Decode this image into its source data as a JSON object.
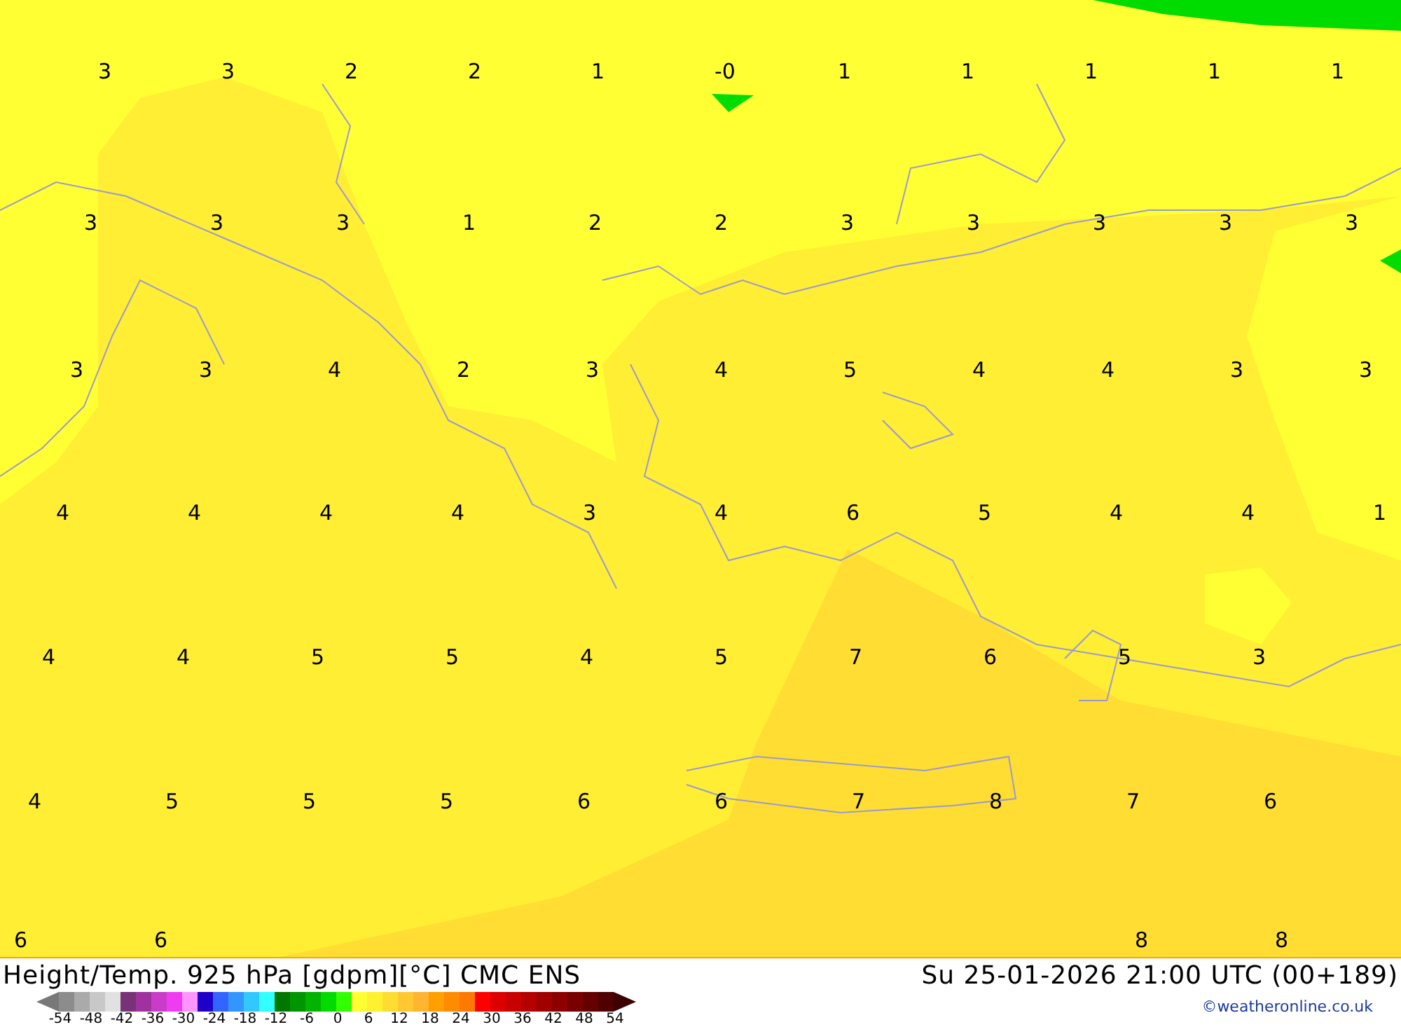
{
  "map": {
    "label_rows": [
      [
        "3",
        "3",
        "2",
        "2",
        "1",
        "-0",
        "1",
        "1",
        "1",
        "1",
        "1"
      ],
      [
        "3",
        "3",
        "3",
        "1",
        "2",
        "2",
        "3",
        "3",
        "3",
        "3",
        "3"
      ],
      [
        "3",
        "3",
        "4",
        "2",
        "3",
        "4",
        "5",
        "4",
        "4",
        "3",
        "3"
      ],
      [
        "4",
        "4",
        "4",
        "4",
        "3",
        "4",
        "6",
        "5",
        "4",
        "4",
        "1"
      ],
      [
        "4",
        "4",
        "5",
        "5",
        "4",
        "5",
        "7",
        "6",
        "5",
        "3",
        null
      ],
      [
        "4",
        "5",
        "5",
        "5",
        "6",
        "6",
        "7",
        "8",
        "7",
        "6",
        null
      ],
      [
        "6",
        "6",
        null,
        null,
        null,
        null,
        null,
        null,
        "8",
        "8",
        null
      ]
    ]
  },
  "footer": {
    "title": "Height/Temp. 925 hPa [gdpm][°C] CMC ENS",
    "time": "Su 25-01-2026 21:00 UTC (00+189)",
    "credit": "©weatheronline.co.uk"
  },
  "legend": {
    "swatches": [
      {
        "kind": "arrow-left",
        "color": "#787878"
      },
      {
        "kind": "box",
        "color": "#8c8c8c"
      },
      {
        "kind": "box",
        "color": "#aaaaaa"
      },
      {
        "kind": "box",
        "color": "#c8c8c8"
      },
      {
        "kind": "box",
        "color": "#e1e1e1"
      },
      {
        "kind": "box",
        "color": "#783278"
      },
      {
        "kind": "box",
        "color": "#a032a0"
      },
      {
        "kind": "box",
        "color": "#c83cc8"
      },
      {
        "kind": "box",
        "color": "#f03cf0"
      },
      {
        "kind": "box",
        "color": "#ff96ff"
      },
      {
        "kind": "box",
        "color": "#1e00c8"
      },
      {
        "kind": "box",
        "color": "#3264ff"
      },
      {
        "kind": "box",
        "color": "#3296ff"
      },
      {
        "kind": "box",
        "color": "#32c8ff"
      },
      {
        "kind": "box",
        "color": "#32ffff"
      },
      {
        "kind": "box",
        "color": "#007800"
      },
      {
        "kind": "box",
        "color": "#009600"
      },
      {
        "kind": "box",
        "color": "#00b400"
      },
      {
        "kind": "box",
        "color": "#00dc00"
      },
      {
        "kind": "box",
        "color": "#32ff00"
      },
      {
        "kind": "box",
        "color": "#ffff32"
      },
      {
        "kind": "box",
        "color": "#fff032"
      },
      {
        "kind": "box",
        "color": "#ffdc32"
      },
      {
        "kind": "box",
        "color": "#ffc832"
      },
      {
        "kind": "box",
        "color": "#ffb432"
      },
      {
        "kind": "box",
        "color": "#ffa000"
      },
      {
        "kind": "box",
        "color": "#ff8c00"
      },
      {
        "kind": "box",
        "color": "#ff7800"
      },
      {
        "kind": "box",
        "color": "#ff0000"
      },
      {
        "kind": "box",
        "color": "#dc0000"
      },
      {
        "kind": "box",
        "color": "#c80000"
      },
      {
        "kind": "box",
        "color": "#b40000"
      },
      {
        "kind": "box",
        "color": "#a00000"
      },
      {
        "kind": "box",
        "color": "#8c0000"
      },
      {
        "kind": "box",
        "color": "#780000"
      },
      {
        "kind": "box",
        "color": "#640000"
      },
      {
        "kind": "box",
        "color": "#500000"
      },
      {
        "kind": "arrow-right",
        "color": "#3c0000"
      }
    ],
    "ticks": [
      "-54",
      "-48",
      "-42",
      "-36",
      "-30",
      "-24",
      "-18",
      "-12",
      "-6",
      "0",
      "6",
      "12",
      "18",
      "24",
      "30",
      "36",
      "42",
      "48",
      "54"
    ]
  }
}
